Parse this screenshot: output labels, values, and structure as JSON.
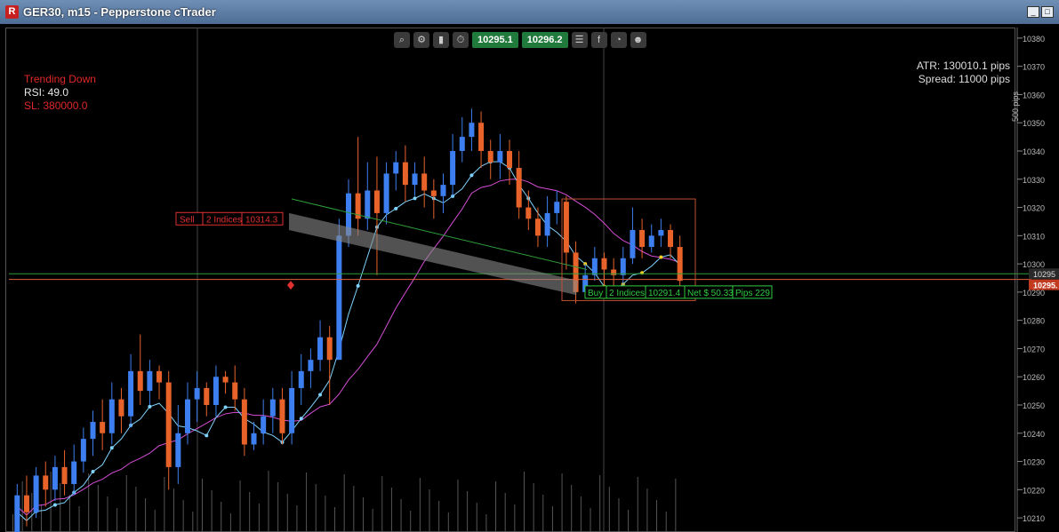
{
  "window": {
    "title": "GER30, m15 - Pepperstone cTrader",
    "app_icon_letter": "R",
    "buttons": {
      "minimize": "_",
      "maximize": "□",
      "close": "×"
    }
  },
  "toolbar": {
    "icons": [
      "zoom-icon",
      "settings-icon",
      "candles-icon",
      "timeframe-icon"
    ],
    "sell_price": "10295.1",
    "buy_price": "10296.2",
    "right_icons": [
      "list-icon",
      "facebook-icon",
      "chart-pie-icon",
      "user-icon"
    ]
  },
  "overlay": {
    "trend": "Trending Down",
    "rsi": "RSI: 49.0",
    "sl": "SL: 380000.0",
    "atr": "ATR: 130010.1 pips",
    "spread": "Spread: 11000 pips"
  },
  "colors": {
    "bull": "#3d7ff0",
    "bear": "#e8632a",
    "ma_fast": "#7fd4ff",
    "ma_slow": "#d64dd6",
    "ma_yellow": "#f5d020",
    "bid_line": "#2e9e3a",
    "ask_line": "#e0603a",
    "sell_label": "#e03030",
    "buy_label": "#2ecc40"
  },
  "axis": {
    "ticks": [
      "10380",
      "10370",
      "10360",
      "10350",
      "10340",
      "10330",
      "10320",
      "10310",
      "10300",
      "10290",
      "10280",
      "10270",
      "10260",
      "10250",
      "10240",
      "10230",
      "10220",
      "10210"
    ],
    "scale_label": "500 pips",
    "current_price": "10295.",
    "current_bid": "10295"
  },
  "trades": {
    "sell": {
      "side": "Sell",
      "qty": "2 Indices",
      "price": "10314.3"
    },
    "buy": {
      "side": "Buy",
      "qty": "2 Indices",
      "price": "10291.4",
      "net": "Net $ 50.33",
      "pips": "Pips 229"
    }
  },
  "chart_data": {
    "type": "candlestick",
    "symbol": "GER30",
    "timeframe": "m15",
    "ylim": [
      10205,
      10385
    ],
    "candles": [
      [
        10205,
        10218,
        10200,
        10222
      ],
      [
        10218,
        10212,
        10207,
        10225
      ],
      [
        10212,
        10225,
        10210,
        10228
      ],
      [
        10225,
        10220,
        10214,
        10230
      ],
      [
        10220,
        10228,
        10216,
        10232
      ],
      [
        10228,
        10222,
        10218,
        10234
      ],
      [
        10222,
        10230,
        10218,
        10236
      ],
      [
        10230,
        10238,
        10226,
        10242
      ],
      [
        10238,
        10244,
        10232,
        10248
      ],
      [
        10244,
        10240,
        10234,
        10252
      ],
      [
        10240,
        10252,
        10236,
        10258
      ],
      [
        10252,
        10246,
        10240,
        10256
      ],
      [
        10246,
        10262,
        10242,
        10268
      ],
      [
        10262,
        10255,
        10250,
        10275
      ],
      [
        10255,
        10262,
        10250,
        10266
      ],
      [
        10262,
        10258,
        10252,
        10264
      ],
      [
        10258,
        10228,
        10220,
        10262
      ],
      [
        10228,
        10240,
        10222,
        10250
      ],
      [
        10240,
        10252,
        10236,
        10258
      ],
      [
        10252,
        10256,
        10244,
        10262
      ],
      [
        10256,
        10250,
        10246,
        10258
      ],
      [
        10250,
        10260,
        10246,
        10264
      ],
      [
        10260,
        10258,
        10254,
        10262
      ],
      [
        10258,
        10252,
        10248,
        10264
      ],
      [
        10252,
        10236,
        10232,
        10256
      ],
      [
        10236,
        10240,
        10234,
        10244
      ],
      [
        10240,
        10246,
        10236,
        10252
      ],
      [
        10246,
        10252,
        10240,
        10256
      ],
      [
        10252,
        10240,
        10236,
        10256
      ],
      [
        10240,
        10256,
        10236,
        10262
      ],
      [
        10256,
        10262,
        10250,
        10268
      ],
      [
        10262,
        10266,
        10256,
        10270
      ],
      [
        10266,
        10274,
        10262,
        10280
      ],
      [
        10274,
        10266,
        10250,
        10278
      ],
      [
        10266,
        10310,
        10282,
        10316
      ],
      [
        10310,
        10325,
        10306,
        10330
      ],
      [
        10325,
        10316,
        10310,
        10345
      ],
      [
        10316,
        10326,
        10312,
        10336
      ],
      [
        10326,
        10318,
        10296,
        10338
      ],
      [
        10318,
        10332,
        10314,
        10336
      ],
      [
        10332,
        10336,
        10326,
        10340
      ],
      [
        10336,
        10328,
        10322,
        10342
      ],
      [
        10328,
        10332,
        10324,
        10336
      ],
      [
        10332,
        10326,
        10320,
        10338
      ],
      [
        10326,
        10324,
        10316,
        10330
      ],
      [
        10324,
        10328,
        10318,
        10332
      ],
      [
        10328,
        10340,
        10324,
        10346
      ],
      [
        10340,
        10345,
        10336,
        10352
      ],
      [
        10345,
        10350,
        10340,
        10355
      ],
      [
        10350,
        10340,
        10334,
        10354
      ],
      [
        10340,
        10336,
        10330,
        10344
      ],
      [
        10336,
        10340,
        10330,
        10346
      ],
      [
        10340,
        10334,
        10328,
        10344
      ],
      [
        10334,
        10320,
        10316,
        10340
      ],
      [
        10320,
        10316,
        10312,
        10326
      ],
      [
        10316,
        10310,
        10306,
        10320
      ],
      [
        10310,
        10318,
        10306,
        10324
      ],
      [
        10318,
        10322,
        10314,
        10326
      ],
      [
        10322,
        10304,
        10298,
        10324
      ],
      [
        10304,
        10290,
        10286,
        10308
      ],
      [
        10290,
        10296,
        10288,
        10300
      ],
      [
        10296,
        10302,
        10294,
        10306
      ],
      [
        10302,
        10298,
        10290,
        10304
      ],
      [
        10298,
        10296,
        10292,
        10302
      ],
      [
        10296,
        10302,
        10292,
        10306
      ],
      [
        10302,
        10312,
        10300,
        10320
      ],
      [
        10312,
        10306,
        10302,
        10316
      ],
      [
        10306,
        10310,
        10304,
        10314
      ],
      [
        10310,
        10312,
        10306,
        10316
      ],
      [
        10312,
        10306,
        10302,
        10314
      ],
      [
        10306,
        10294,
        10290,
        10310
      ]
    ]
  }
}
